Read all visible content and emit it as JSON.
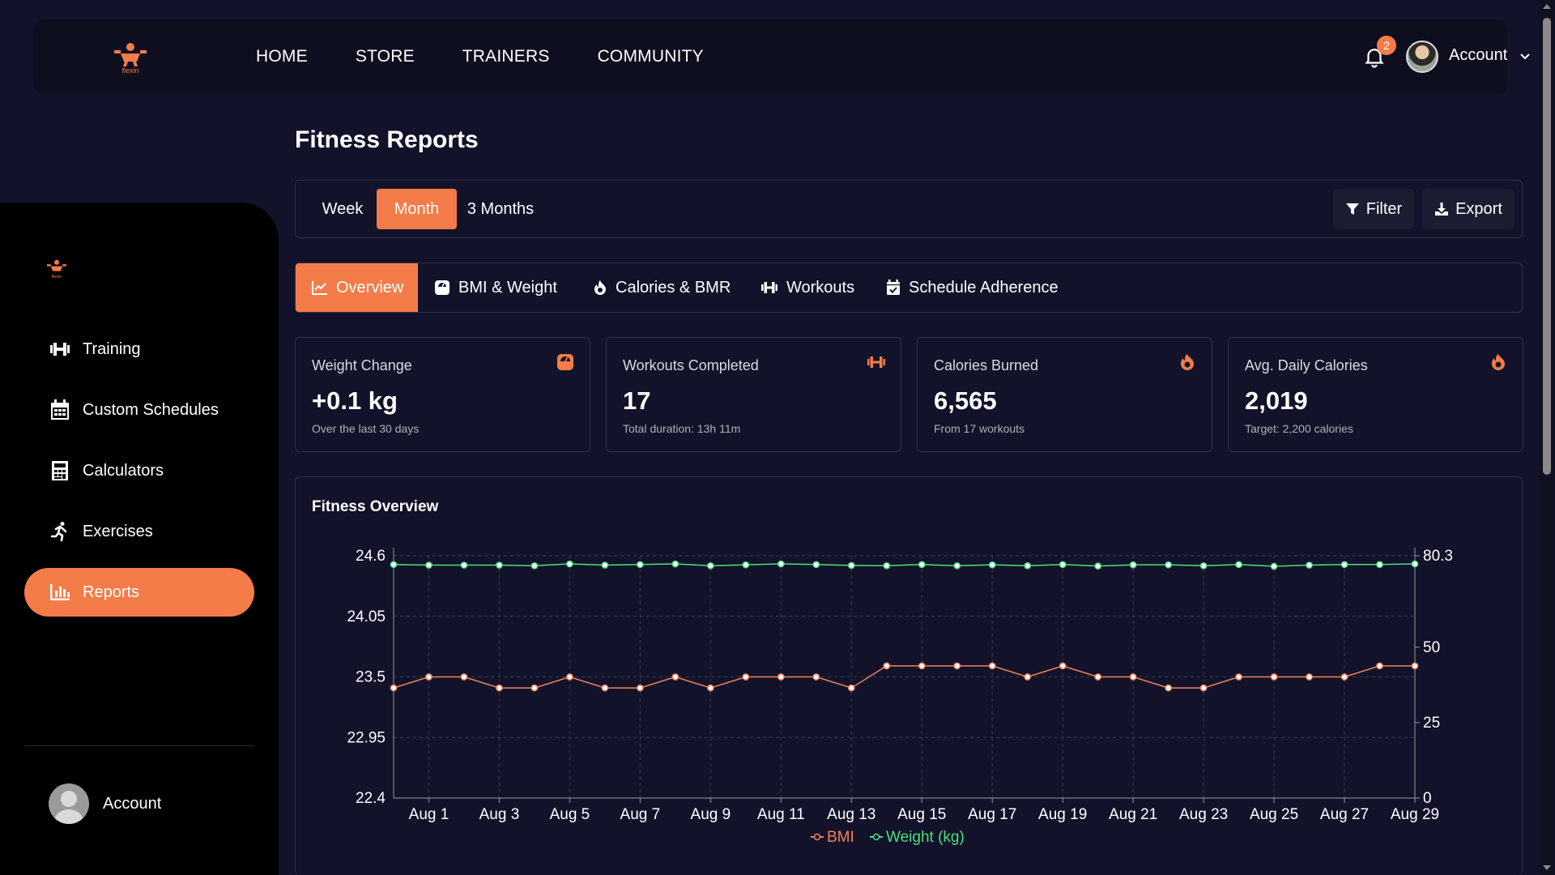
{
  "nav": {
    "logo_text": "flexin",
    "links": [
      "HOME",
      "STORE",
      "TRAINERS",
      "COMMUNITY"
    ],
    "notification_count": "2",
    "account_label": "Account"
  },
  "sidebar": {
    "logo_text": "flexin",
    "items": [
      {
        "label": "Training",
        "icon": "dumbbell-icon"
      },
      {
        "label": "Custom Schedules",
        "icon": "calendar-icon"
      },
      {
        "label": "Calculators",
        "icon": "calculator-icon"
      },
      {
        "label": "Exercises",
        "icon": "running-icon"
      },
      {
        "label": "Reports",
        "icon": "bar-chart-icon",
        "active": true
      }
    ],
    "account_label": "Account"
  },
  "page": {
    "title": "Fitness Reports",
    "periods": [
      "Week",
      "Month",
      "3 Months"
    ],
    "active_period": "Month",
    "filter_label": "Filter",
    "export_label": "Export"
  },
  "tabs": [
    {
      "label": "Overview",
      "icon": "line-chart-icon",
      "active": true
    },
    {
      "label": "BMI & Weight",
      "icon": "scale-icon"
    },
    {
      "label": "Calories & BMR",
      "icon": "fire-icon"
    },
    {
      "label": "Workouts",
      "icon": "dumbbell-icon"
    },
    {
      "label": "Schedule Adherence",
      "icon": "calendar-check-icon"
    }
  ],
  "cards": [
    {
      "title": "Weight Change",
      "value": "+0.1 kg",
      "sub": "Over the last 30 days",
      "icon": "scale-icon"
    },
    {
      "title": "Workouts Completed",
      "value": "17",
      "sub": "Total duration: 13h 11m",
      "icon": "dumbbell-icon"
    },
    {
      "title": "Calories Burned",
      "value": "6,565",
      "sub": "From 17 workouts",
      "icon": "fire-icon"
    },
    {
      "title": "Avg. Daily Calories",
      "value": "2,019",
      "sub": "Target: 2,200 calories",
      "icon": "fire-icon"
    }
  ],
  "colors": {
    "accent": "#f47c48",
    "bmi_line": "#f2825a",
    "weight_line": "#4ade80",
    "background": "#12132a"
  },
  "chart_data": {
    "type": "line",
    "title": "Fitness Overview",
    "x": [
      "Jul 31",
      "Aug 1",
      "Aug 2",
      "Aug 3",
      "Aug 4",
      "Aug 5",
      "Aug 6",
      "Aug 7",
      "Aug 8",
      "Aug 9",
      "Aug 10",
      "Aug 11",
      "Aug 12",
      "Aug 13",
      "Aug 14",
      "Aug 15",
      "Aug 16",
      "Aug 17",
      "Aug 18",
      "Aug 19",
      "Aug 20",
      "Aug 21",
      "Aug 22",
      "Aug 23",
      "Aug 24",
      "Aug 25",
      "Aug 26",
      "Aug 27",
      "Aug 28",
      "Aug 29"
    ],
    "x_tick_labels": [
      "Aug 1",
      "Aug 3",
      "Aug 5",
      "Aug 7",
      "Aug 9",
      "Aug 11",
      "Aug 13",
      "Aug 15",
      "Aug 17",
      "Aug 19",
      "Aug 21",
      "Aug 23",
      "Aug 25",
      "Aug 27",
      "Aug 29"
    ],
    "y_left": {
      "ticks": [
        "24.6",
        "24.05",
        "23.5",
        "22.95",
        "22.4"
      ],
      "range": [
        22.4,
        24.6
      ]
    },
    "y_right": {
      "ticks": [
        "80.3",
        "50",
        "25",
        "0"
      ],
      "range": [
        0,
        80.3
      ]
    },
    "series": [
      {
        "name": "BMI",
        "axis": "left",
        "values": [
          23.4,
          23.5,
          23.5,
          23.4,
          23.4,
          23.5,
          23.4,
          23.4,
          23.5,
          23.4,
          23.5,
          23.5,
          23.5,
          23.4,
          23.6,
          23.6,
          23.6,
          23.6,
          23.5,
          23.6,
          23.5,
          23.5,
          23.4,
          23.4,
          23.5,
          23.5,
          23.5,
          23.5,
          23.6,
          23.6
        ]
      },
      {
        "name": "Weight (kg)",
        "axis": "right",
        "values": [
          77.4,
          77.2,
          77.2,
          77.2,
          77.0,
          77.6,
          77.2,
          77.4,
          77.6,
          77.0,
          77.3,
          77.6,
          77.4,
          77.1,
          77.0,
          77.4,
          77.0,
          77.3,
          77.0,
          77.4,
          76.9,
          77.3,
          77.3,
          77.0,
          77.4,
          76.8,
          77.2,
          77.4,
          77.4,
          77.6
        ]
      }
    ],
    "legend_position": "bottom",
    "grid": true
  }
}
